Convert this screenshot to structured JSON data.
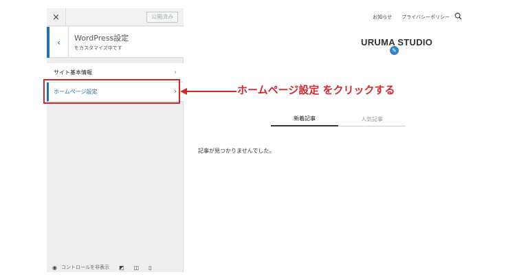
{
  "sidebar": {
    "close_icon": "×",
    "publish_label": "公開済み",
    "header_title": "WordPress設定",
    "header_subtitle": "をカスタマイズ中です",
    "back_icon": "‹",
    "items": [
      {
        "label": "サイト基本情報",
        "chevron": "›"
      },
      {
        "label": "ホームページ設定",
        "chevron": "›"
      }
    ],
    "footer_label": "コントロールを非表示",
    "footer_icons": [
      "◉",
      "◩",
      "◫",
      "▯"
    ]
  },
  "preview": {
    "nav": [
      "お知らせ",
      "プライバシーポリシー"
    ],
    "brand": "URUMA STUDIO",
    "pencil_icon": "✎",
    "tabs": [
      {
        "label": "新着記事",
        "active": true
      },
      {
        "label": "人気記事",
        "active": false
      }
    ],
    "empty_message": "記事が見つかりませんでした。"
  },
  "annotation": {
    "text": "ホームページ設定 をクリックする",
    "color": "#d6262b"
  },
  "colors": {
    "accent": "#2271b1",
    "highlight": "#d6262b"
  }
}
